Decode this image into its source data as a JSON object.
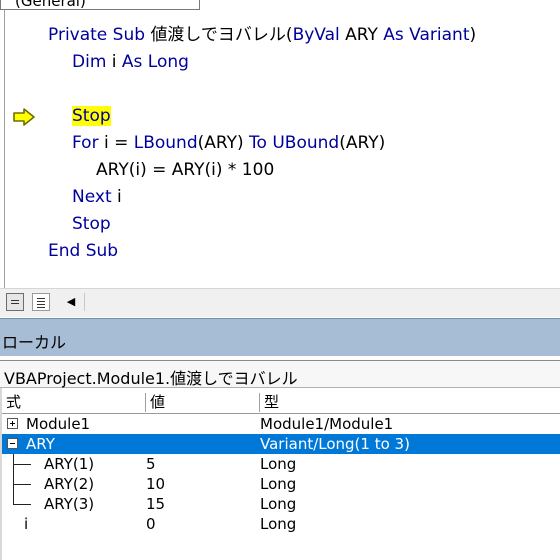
{
  "code_window": {
    "object_combo": "(General)",
    "code_lines": [
      {
        "parts": [
          {
            "t": "Private Sub ",
            "k": true
          },
          {
            "t": "値渡しでヨバレル(",
            "k": false
          },
          {
            "t": "ByVal",
            "k": true
          },
          {
            "t": " ARY ",
            "k": false
          },
          {
            "t": "As Variant",
            "k": true
          },
          {
            "t": ")",
            "k": false
          }
        ]
      },
      {
        "parts": [
          {
            "t": "Dim",
            "k": true
          },
          {
            "t": " i ",
            "k": false
          },
          {
            "t": "As Long",
            "k": true
          }
        ]
      },
      {
        "parts": []
      },
      {
        "parts": [
          {
            "t": "Stop",
            "k": true,
            "hl": true
          }
        ]
      },
      {
        "parts": [
          {
            "t": "For",
            "k": true
          },
          {
            "t": " i = ",
            "k": false
          },
          {
            "t": "LBound",
            "k": true
          },
          {
            "t": "(ARY) ",
            "k": false
          },
          {
            "t": "To",
            "k": true
          },
          {
            "t": " ",
            "k": false
          },
          {
            "t": "UBound",
            "k": true
          },
          {
            "t": "(ARY)",
            "k": false
          }
        ]
      },
      {
        "parts": [
          {
            "t": "ARY(i) = ARY(i) * 100",
            "k": false
          }
        ]
      },
      {
        "parts": [
          {
            "t": "Next",
            "k": true
          },
          {
            "t": " i",
            "k": false
          }
        ]
      },
      {
        "parts": [
          {
            "t": "Stop",
            "k": true
          }
        ]
      },
      {
        "parts": [
          {
            "t": "End Sub",
            "k": true
          }
        ]
      }
    ],
    "execution_arrow_line": 3,
    "colors": {
      "keyword": "#00009c",
      "highlight": "#ffff00",
      "arrow_fill": "#ffff00",
      "arrow_stroke": "#6e6e00"
    }
  },
  "locals": {
    "title": "ローカル",
    "context": "VBAProject.Module1.値渡しでヨバレル",
    "headers": {
      "expr": "式",
      "value": "値",
      "type": "型"
    },
    "rows": [
      {
        "expr": "Module1",
        "value": "",
        "type": "Module1/Module1",
        "expander": "plus",
        "selected": false
      },
      {
        "expr": "ARY",
        "value": "",
        "type": "Variant/Long(1 to 3)",
        "expander": "minus",
        "selected": true
      },
      {
        "expr": "ARY(1)",
        "value": "5",
        "type": "Long"
      },
      {
        "expr": "ARY(2)",
        "value": "10",
        "type": "Long"
      },
      {
        "expr": "ARY(3)",
        "value": "15",
        "type": "Long"
      },
      {
        "expr": "i",
        "value": "0",
        "type": "Long"
      }
    ],
    "colors": {
      "title_bar": "#a7bdd6",
      "selection": "#0078d7"
    }
  }
}
